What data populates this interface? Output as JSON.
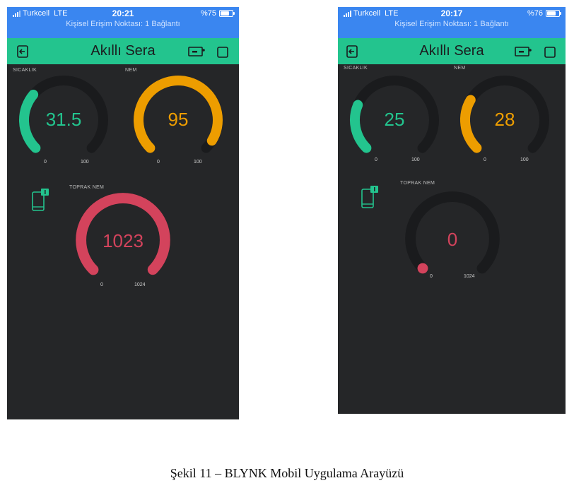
{
  "colors": {
    "green": "#23c48e",
    "orange": "#ed9d00",
    "red": "#d3435c",
    "track": "#1a1b1d"
  },
  "phones": [
    {
      "status": {
        "carrier": "Turkcell",
        "network": "LTE",
        "time": "20:21",
        "battery": "%75",
        "battery_level": 0.75,
        "hotspot": "Kişisel Erişim Noktası: 1 Bağlantı"
      },
      "app_title": "Akıllı Sera",
      "gauges": [
        {
          "label": "SICAKLIK",
          "value": "31.5",
          "min": "0",
          "max": "100",
          "level": 0.315,
          "color": "green"
        },
        {
          "label": "NEM",
          "value": "95",
          "min": "0",
          "max": "100",
          "level": 0.95,
          "color": "orange"
        },
        {
          "label": "TOPRAK NEM",
          "value": "1023",
          "min": "0",
          "max": "1024",
          "level": 0.999,
          "color": "red"
        }
      ]
    },
    {
      "status": {
        "carrier": "Turkcell",
        "network": "LTE",
        "time": "20:17",
        "battery": "%76",
        "battery_level": 0.76,
        "hotspot": "Kişisel Erişim Noktası: 1 Bağlantı"
      },
      "app_title": "Akıllı Sera",
      "gauges": [
        {
          "label": "SICAKLIK",
          "value": "25",
          "min": "0",
          "max": "100",
          "level": 0.25,
          "color": "green"
        },
        {
          "label": "NEM",
          "value": "28",
          "min": "0",
          "max": "100",
          "level": 0.28,
          "color": "orange"
        },
        {
          "label": "TOPRAK NEM",
          "value": "0",
          "min": "0",
          "max": "1024",
          "level": 0.0,
          "color": "red"
        }
      ]
    }
  ],
  "caption": "Şekil 11 – BLYNK Mobil Uygulama Arayüzü"
}
